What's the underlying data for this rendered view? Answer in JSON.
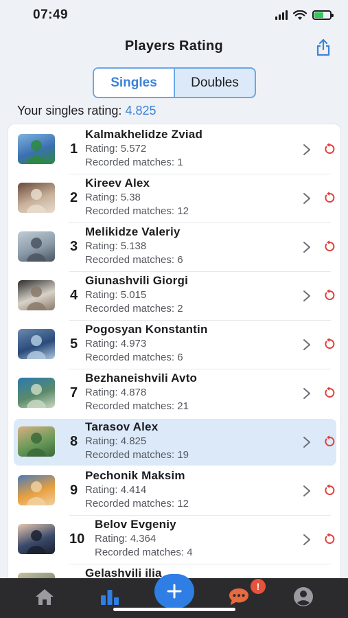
{
  "status": {
    "time": "07:49"
  },
  "header": {
    "title": "Players Rating"
  },
  "tabs": {
    "singles": "Singles",
    "doubles": "Doubles",
    "active": "singles"
  },
  "your_rating": {
    "label": "Your singles rating: ",
    "value": "4.825"
  },
  "players": [
    {
      "rank": "1",
      "name": "Kalmakhelidze Zviad",
      "rating": "Rating: 5.572",
      "matches": "Recorded matches: 1",
      "highlight": false
    },
    {
      "rank": "2",
      "name": "Kireev Alex",
      "rating": "Rating: 5.38",
      "matches": "Recorded matches: 12",
      "highlight": false
    },
    {
      "rank": "3",
      "name": "Melikidze Valeriy",
      "rating": "Rating: 5.138",
      "matches": "Recorded matches: 6",
      "highlight": false
    },
    {
      "rank": "4",
      "name": "Giunashvili Giorgi",
      "rating": "Rating: 5.015",
      "matches": "Recorded matches: 2",
      "highlight": false
    },
    {
      "rank": "5",
      "name": "Pogosyan Konstantin",
      "rating": "Rating: 4.973",
      "matches": "Recorded matches: 6",
      "highlight": false
    },
    {
      "rank": "7",
      "name": "Bezhaneishvili Avto",
      "rating": "Rating: 4.878",
      "matches": "Recorded matches: 21",
      "highlight": false
    },
    {
      "rank": "8",
      "name": "Tarasov Alex",
      "rating": "Rating: 4.825",
      "matches": "Recorded matches: 19",
      "highlight": true
    },
    {
      "rank": "9",
      "name": "Pechonik Maksim",
      "rating": "Rating: 4.414",
      "matches": "Recorded matches: 12",
      "highlight": false
    },
    {
      "rank": "10",
      "name": "Belov Evgeniy",
      "rating": "Rating: 4.364",
      "matches": "Recorded matches: 4",
      "highlight": false
    },
    {
      "rank": "",
      "name": "Gelashvili ilia",
      "rating": "",
      "matches": "",
      "highlight": false
    }
  ],
  "tab_bar": {
    "items": [
      "home-icon",
      "bar-chart-icon",
      "plus-icon",
      "chat-icon",
      "profile-icon"
    ],
    "active": "bar-chart-icon",
    "chat_badge": "!"
  },
  "colors": {
    "accent": "#3d82d6",
    "reset_icon": "#e0403a",
    "tab_bar_bg": "#2b2b2e",
    "highlight_row": "#dbe9f8",
    "badge": "#e5533c"
  }
}
